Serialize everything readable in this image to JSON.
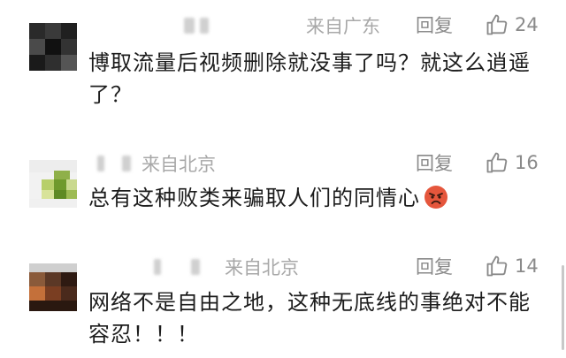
{
  "comments": [
    {
      "location": "来自广东",
      "reply": "回复",
      "likes": "24",
      "text": "博取流量后视频删除就没事了吗？就这么逍遥了？",
      "icons": [
        "thumbs-up-icon"
      ]
    },
    {
      "location": "来自北京",
      "reply": "回复",
      "likes": "16",
      "text": "总有这种败类来骗取人们的同情心",
      "icons": [
        "thumbs-up-icon",
        "angry-face-emoji"
      ]
    },
    {
      "location": "来自北京",
      "reply": "回复",
      "likes": "14",
      "text": "网络不是自由之地，这种无底线的事绝对不能容忍！！！",
      "icons": [
        "thumbs-up-icon"
      ]
    }
  ],
  "colors": {
    "meta_text": "#a8a8a8",
    "action_text": "#8a8a8a",
    "body_text": "#1c1c1c",
    "emoji_face": "#e5563c"
  }
}
